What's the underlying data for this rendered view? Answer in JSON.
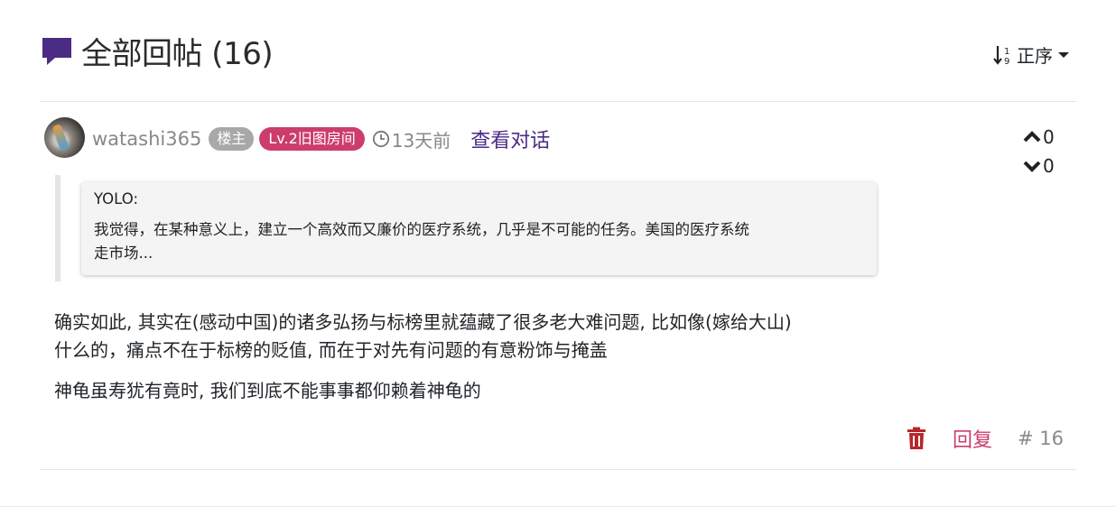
{
  "header": {
    "title": "全部回帖 (16)",
    "icon": "comment-icon",
    "sort_label": "正序",
    "sort_icon": "sort-numeric-icon"
  },
  "post": {
    "username": "watashi365",
    "owner_badge": "楼主",
    "level_badge": "Lv.2旧图房间",
    "time": "13天前",
    "view_conversation": "查看对话",
    "upvotes": "0",
    "downvotes": "0",
    "quote": {
      "author": "YOLO:",
      "text_line1": "我觉得，在某种意义上，建立一个高效而又廉价的医疗系统，几乎是不可能的任务。美国的医疗系统",
      "text_line2": "走市场..."
    },
    "body": [
      "确实如此, 其实在(感动中国)的诸多弘扬与标榜里就蕴藏了很多老大难问题, 比如像(嫁给大山)",
      "什么的，痛点不在于标榜的贬值, 而在于对先有问题的有意粉饰与掩盖",
      "神龟虽寿犹有竟时, 我们到底不能事事都仰赖着神龟的"
    ],
    "reply_label": "回复",
    "post_number": "# 16"
  },
  "colors": {
    "accent_purple": "#4b2c85",
    "badge_pink": "#cc3d6c",
    "badge_gray": "#a8a8a8",
    "trash_red": "#b8262b"
  }
}
